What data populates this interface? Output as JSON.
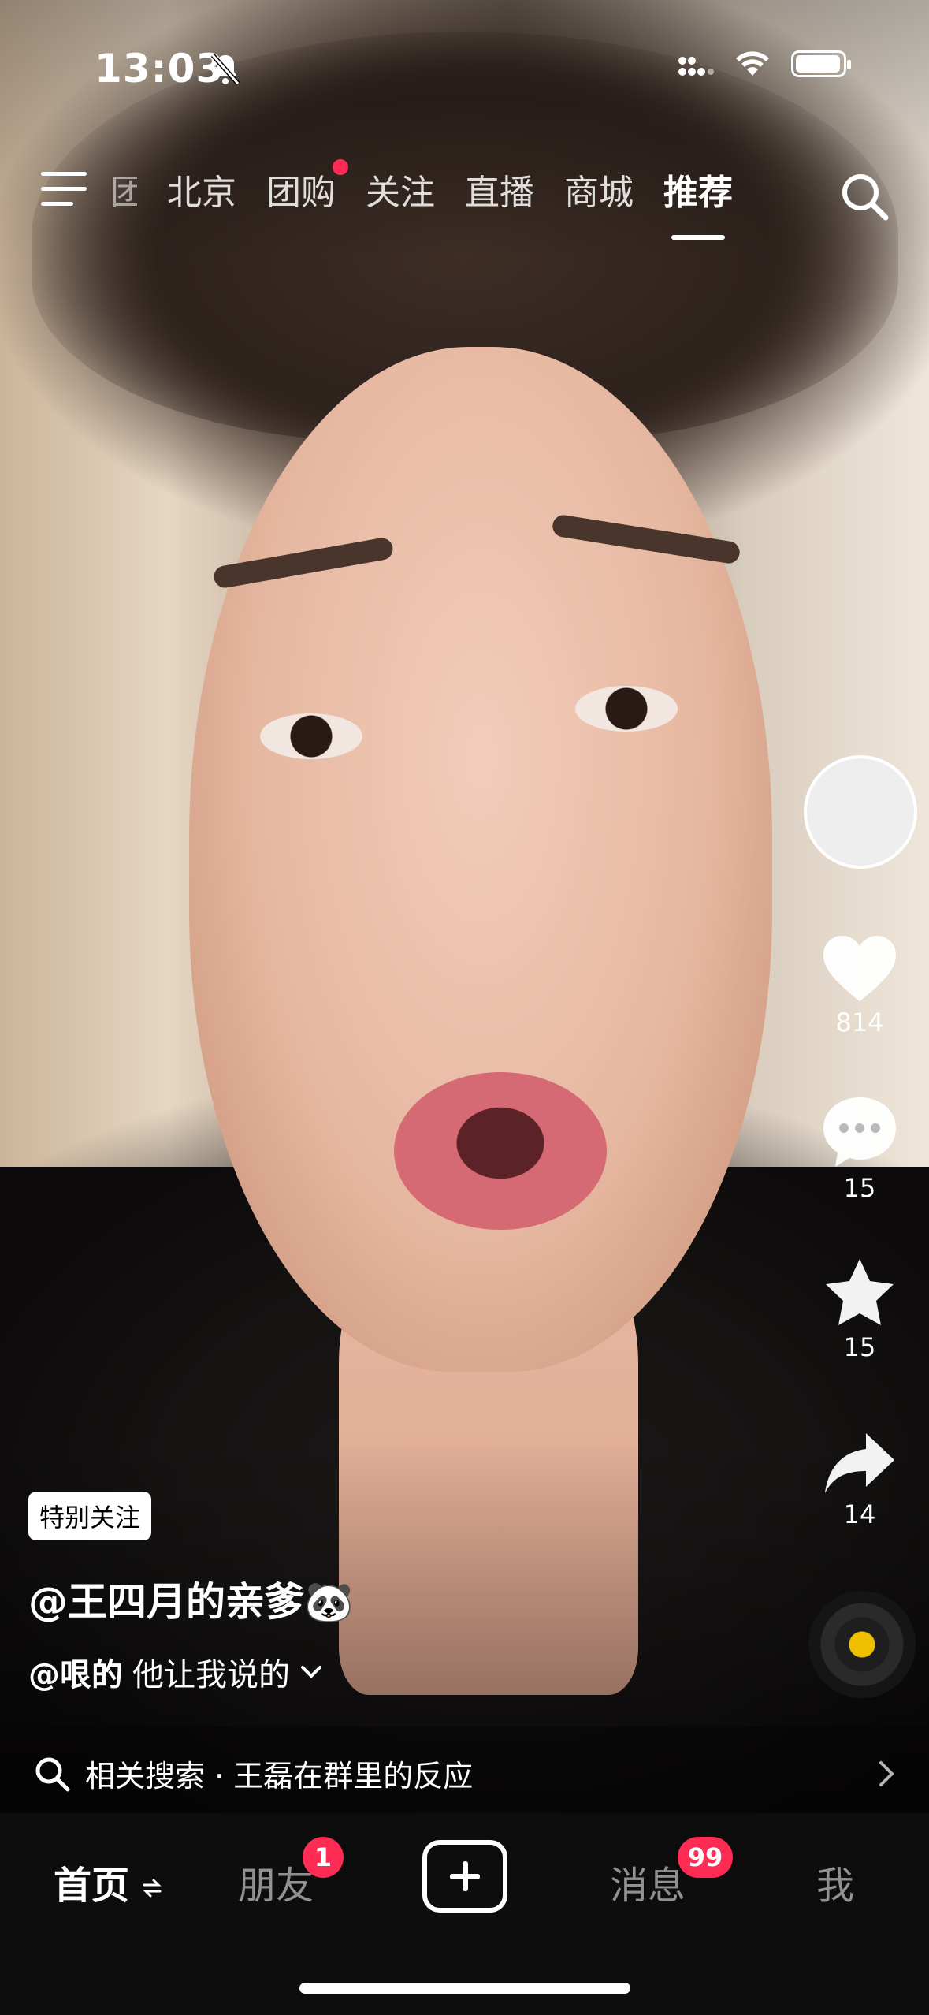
{
  "status_bar": {
    "time": "13:03"
  },
  "top_tabs": [
    {
      "label": "团"
    },
    {
      "label": "北京"
    },
    {
      "label": "团购"
    },
    {
      "label": "关注"
    },
    {
      "label": "直播"
    },
    {
      "label": "商城"
    },
    {
      "label": "推荐"
    }
  ],
  "active_tab": "推荐",
  "right_rail": {
    "like_count": "814",
    "comment_count": "15",
    "favorite_count": "15",
    "share_count": "14"
  },
  "video": {
    "badge": "特别关注",
    "author": "@王四月的亲爹🐼",
    "caption_mention": "@哏的",
    "caption_text": "他让我说的"
  },
  "related_search": {
    "text": "相关搜索 · 王磊在群里的反应"
  },
  "bottom_tabs": {
    "home": "首页",
    "friends": "朋友",
    "friends_badge": "1",
    "messages": "消息",
    "messages_badge": "99",
    "me": "我"
  },
  "colors": {
    "accent": "#fe2c55",
    "tabbar_bg": "#0d0d0d",
    "music_disc_center": "#f0c000"
  }
}
